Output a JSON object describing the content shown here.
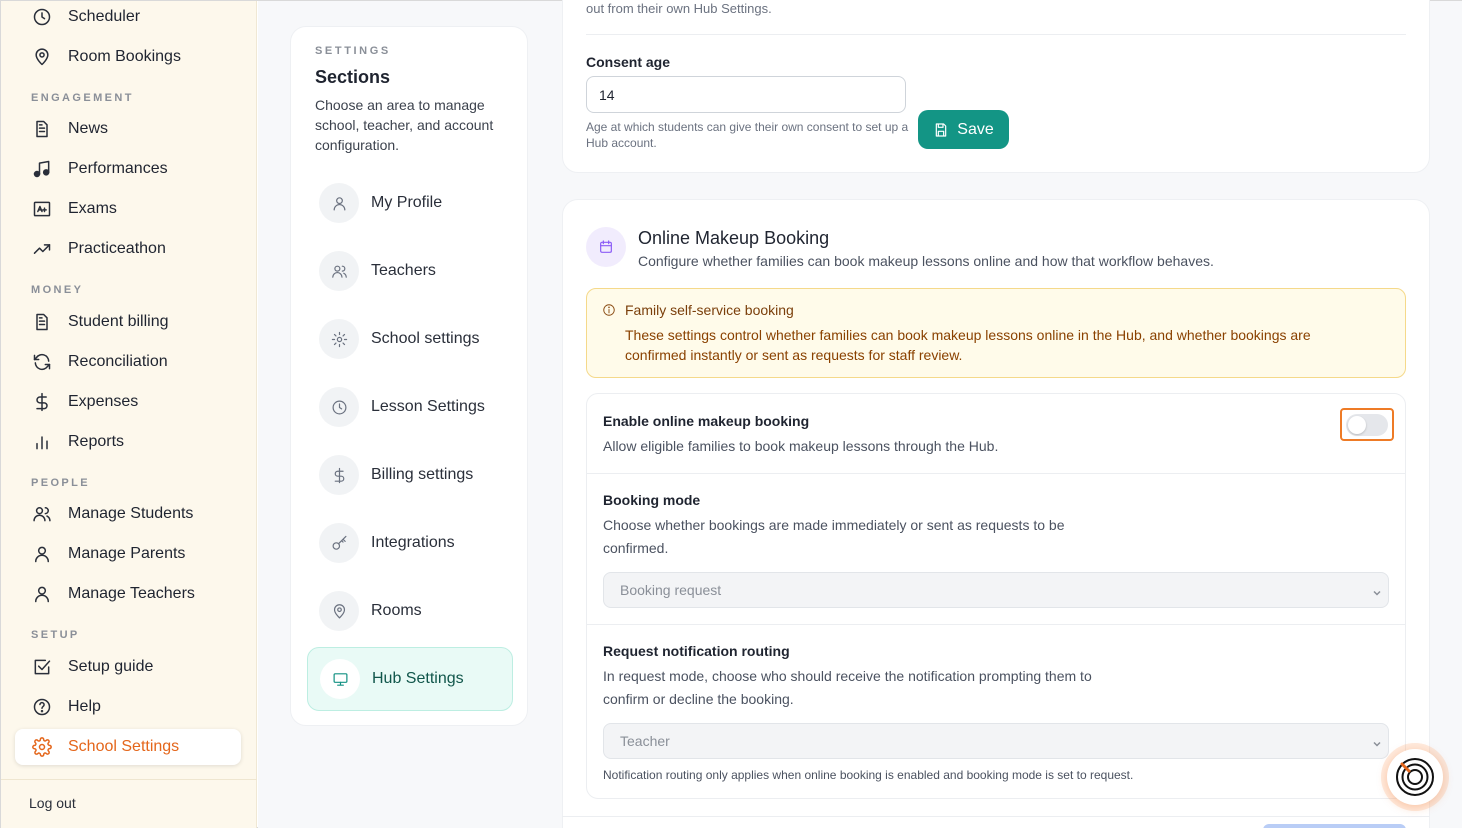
{
  "nav": {
    "items_top": [
      {
        "label": "Scheduler",
        "icon": "clock-icon"
      },
      {
        "label": "Room Bookings",
        "icon": "map-pin-icon"
      }
    ],
    "sections": {
      "engagement": "ENGAGEMENT",
      "money": "MONEY",
      "people": "PEOPLE",
      "setup": "SETUP"
    },
    "engagement": [
      {
        "label": "News",
        "icon": "document-icon"
      },
      {
        "label": "Performances",
        "icon": "music-note-icon"
      },
      {
        "label": "Exams",
        "icon": "grade-icon"
      },
      {
        "label": "Practiceathon",
        "icon": "trend-up-icon"
      }
    ],
    "money": [
      {
        "label": "Student billing",
        "icon": "document-icon"
      },
      {
        "label": "Reconciliation",
        "icon": "refresh-icon"
      },
      {
        "label": "Expenses",
        "icon": "dollar-icon"
      },
      {
        "label": "Reports",
        "icon": "bar-chart-icon"
      }
    ],
    "people": [
      {
        "label": "Manage Students",
        "icon": "users-icon"
      },
      {
        "label": "Manage Parents",
        "icon": "user-icon"
      },
      {
        "label": "Manage Teachers",
        "icon": "user-icon"
      }
    ],
    "setup": [
      {
        "label": "Setup guide",
        "icon": "checkbox-icon"
      },
      {
        "label": "Help",
        "icon": "help-circle-icon"
      },
      {
        "label": "School Settings",
        "icon": "gear-icon",
        "active": true
      }
    ],
    "logout": "Log out",
    "accent_color": "#e4661b"
  },
  "settings_sections": {
    "kicker": "SETTINGS",
    "title": "Sections",
    "description": "Choose an area to manage school, teacher, and account configuration.",
    "items": [
      {
        "label": "My Profile",
        "icon": "user-icon"
      },
      {
        "label": "Teachers",
        "icon": "users-icon"
      },
      {
        "label": "School settings",
        "icon": "gear-icon"
      },
      {
        "label": "Lesson Settings",
        "icon": "clock-icon"
      },
      {
        "label": "Billing settings",
        "icon": "dollar-icon"
      },
      {
        "label": "Integrations",
        "icon": "key-icon"
      },
      {
        "label": "Rooms",
        "icon": "map-pin-icon"
      },
      {
        "label": "Hub Settings",
        "icon": "monitor-icon",
        "active": true
      }
    ]
  },
  "consent": {
    "top_text": "out from their own Hub Settings.",
    "label": "Consent age",
    "value": "14",
    "help": "Age at which students can give their own consent to set up a Hub account.",
    "save_label": "Save"
  },
  "online_makeup": {
    "title": "Online Makeup Booking",
    "description": "Configure whether families can book makeup lessons online and how that workflow behaves.",
    "alert_title": "Family self-service booking",
    "alert_body": "These settings control whether families can book makeup lessons online in the Hub, and whether bookings are confirmed instantly or sent as requests for staff review.",
    "enable_title": "Enable online makeup booking",
    "enable_desc": "Allow eligible families to book makeup lessons through the Hub.",
    "enable_value": false,
    "mode_title": "Booking mode",
    "mode_desc": "Choose whether bookings are made immediately or sent as requests to be confirmed.",
    "mode_value": "Booking request",
    "routing_title": "Request notification routing",
    "routing_desc": "In request mode, choose who should receive the notification prompting them to confirm or decline the booking.",
    "routing_value": "Teacher",
    "routing_note": "Notification routing only applies when online booking is enabled and booking mode is set to request."
  },
  "colors": {
    "primary": "#139585",
    "alert_bg": "#fffbea",
    "highlight": "#ee7b26"
  }
}
